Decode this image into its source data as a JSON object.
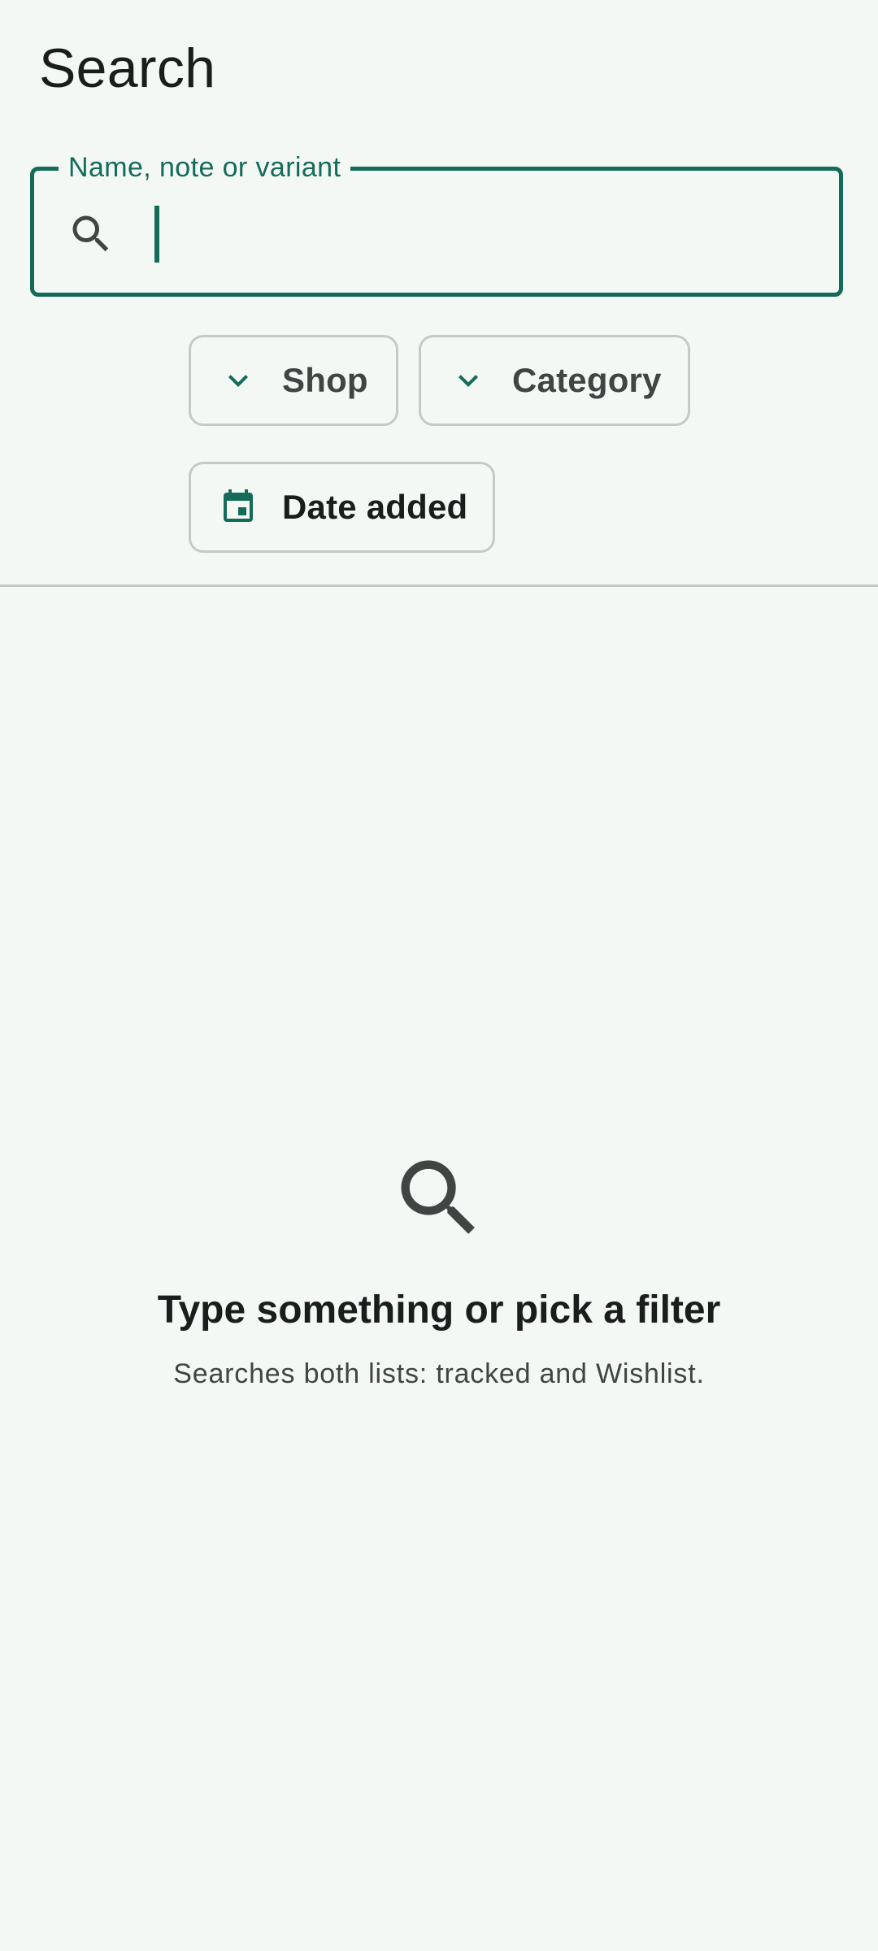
{
  "page": {
    "title": "Search"
  },
  "search": {
    "label": "Name, note or variant",
    "value": "",
    "icon": "search-icon"
  },
  "filters": {
    "shop": {
      "label": "Shop",
      "icon": "chevron-down-icon"
    },
    "category": {
      "label": "Category",
      "icon": "chevron-down-icon"
    },
    "date_added": {
      "label": "Date added",
      "icon": "calendar-icon"
    }
  },
  "empty_state": {
    "icon": "search-icon",
    "title": "Type something or pick a filter",
    "subtitle": "Searches both lists: tracked and Wishlist."
  },
  "colors": {
    "background": "#F3F8F5",
    "accent": "#136B58",
    "outline": "#C4CAC7",
    "text_primary": "#1B1D1C",
    "text_secondary": "#3E4543"
  }
}
